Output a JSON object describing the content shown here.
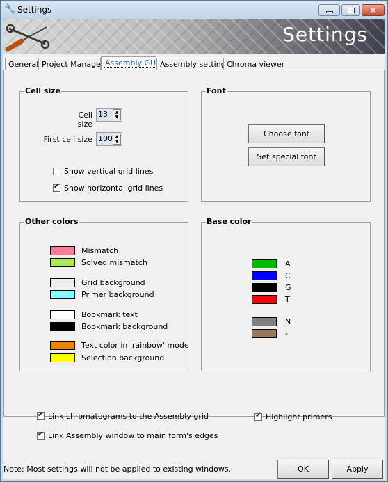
{
  "window": {
    "title": "Settings",
    "icon": "wrench-icon",
    "controls": [
      "minimize",
      "maximize",
      "close"
    ]
  },
  "banner": {
    "title": "Settings",
    "icon": "tools-icon"
  },
  "tabs": [
    {
      "label": "General",
      "active": false
    },
    {
      "label": "Project Manager",
      "active": false
    },
    {
      "label": "Assembly GUI",
      "active": true
    },
    {
      "label": "Assembly settings",
      "active": false
    },
    {
      "label": "Chroma viewer",
      "active": false
    }
  ],
  "cell_size": {
    "title": "Cell size",
    "cell_size_label": "Cell size",
    "cell_size_value": "13",
    "first_cell_size_label": "First cell size",
    "first_cell_size_value": "100",
    "show_vertical_label": "Show vertical grid lines",
    "show_vertical_checked": false,
    "show_horizontal_label": "Show horizontal grid lines",
    "show_horizontal_checked": true
  },
  "font": {
    "title": "Font",
    "choose_font_label": "Choose font",
    "set_special_font_label": "Set special font"
  },
  "other_colors": {
    "title": "Other colors",
    "items": [
      {
        "label": "Mismatch",
        "color": "#ff7b93"
      },
      {
        "label": "Solved mismatch",
        "color": "#aeea52"
      },
      {
        "label": "Grid background",
        "color": "#e9eeee"
      },
      {
        "label": "Primer background",
        "color": "#88fcfc"
      },
      {
        "label": "Bookmark text",
        "color": "#ffffff"
      },
      {
        "label": "Bookmark background",
        "color": "#000000"
      },
      {
        "label": "Text color in 'rainbow' mode",
        "color": "#ee8000"
      },
      {
        "label": "Selection background",
        "color": "#ffff00"
      }
    ]
  },
  "base_color": {
    "title": "Base color",
    "items": [
      {
        "label": "A",
        "color": "#00bb00"
      },
      {
        "label": "C",
        "color": "#0000ff"
      },
      {
        "label": "G",
        "color": "#000000"
      },
      {
        "label": "T",
        "color": "#ff0000"
      },
      {
        "label": "N",
        "color": "#808080"
      },
      {
        "label": "-",
        "color": "#94795a"
      }
    ]
  },
  "options": {
    "link_chromatograms_label": "Link chromatograms to the Assembly grid",
    "link_chromatograms_checked": true,
    "link_window_label": "Link Assembly window to main form's edges",
    "link_window_checked": true,
    "highlight_primers_label": "Highlight primers",
    "highlight_primers_checked": true
  },
  "footer": {
    "note": "Note: Most settings will not be applied to existing windows.",
    "ok_label": "OK",
    "apply_label": "Apply"
  }
}
